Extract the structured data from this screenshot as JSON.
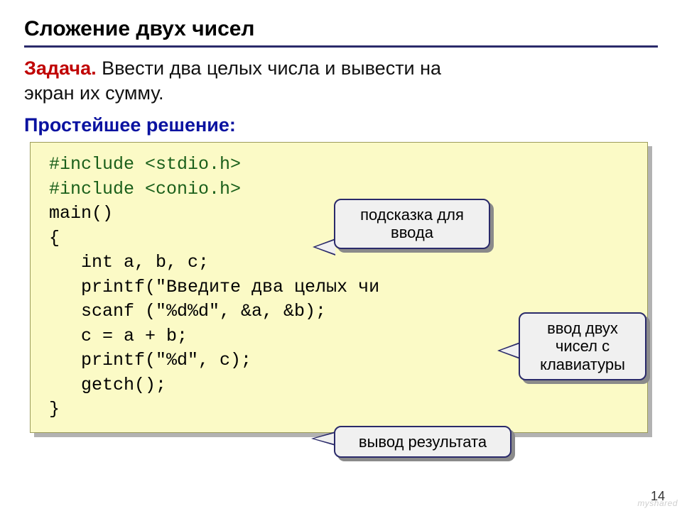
{
  "title": "Сложение двух чисел",
  "task": {
    "label": "Задача.",
    "text_line1": " Ввести два целых числа и вывести на",
    "text_line2": "экран их сумму."
  },
  "solution_label": "Простейшее решение:",
  "code": {
    "l1a": "#include ",
    "l1b": "<stdio.h>",
    "l2a": "#include ",
    "l2b": "<conio.h>",
    "l3": "main()",
    "l4": "{",
    "l5": "   int a, b, c;",
    "l6": "   printf(\"Введите два целых чи",
    "l7": "   scanf (\"%d%d\", &a, &b);",
    "l8": "   c = a + b;",
    "l9": "   printf(\"%d\", c);",
    "l10": "   getch();",
    "l11": "}"
  },
  "callouts": {
    "c1": "подсказка для ввода",
    "c2": "ввод двух чисел с клавиатуры",
    "c3": "вывод результата"
  },
  "page": "14",
  "watermark": "myshared"
}
